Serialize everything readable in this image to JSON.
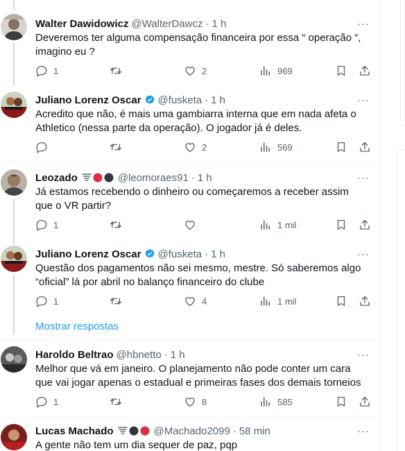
{
  "tweets": [
    {
      "name": "Walter Dawidowicz",
      "handle": "@WalterDawcz",
      "time": "1 h",
      "verified": false,
      "text": "Deveremos ter alguma compensação financeira por essa “ operação “, imagino eu ?",
      "replies": "1",
      "retweets": "",
      "likes": "2",
      "views": "969"
    },
    {
      "name": "Juliano Lorenz Oscar",
      "handle": "@fusketa",
      "time": "1 h",
      "verified": true,
      "text": "Acredito que não, é mais uma gambiarra interna que em nada afeta o Athletico (nessa parte da operação). O jogador já é deles.",
      "replies": "",
      "retweets": "",
      "likes": "2",
      "views": "569"
    },
    {
      "name": "Leozado",
      "handle": "@leomoraes91",
      "time": "1 h",
      "verified": false,
      "text": "Já estamos recebendo o dinheiro ou começaremos a receber assim que o VR partir?",
      "replies": "1",
      "retweets": "",
      "likes": "",
      "views": "1 mil"
    },
    {
      "name": "Juliano Lorenz Oscar",
      "handle": "@fusketa",
      "time": "1 h",
      "verified": true,
      "text": "Questão dos pagamentos não sei mesmo, mestre. Só saberemos algo “oficial” lá por abril no balanço financeiro do clube",
      "replies": "1",
      "retweets": "",
      "likes": "4",
      "views": "1 mil"
    },
    {
      "name": "Haroldo Beltrao",
      "handle": "@hbnetto",
      "time": "1 h",
      "verified": false,
      "text": "Melhor que vá em janeiro.  O planejamento não pode conter um cara que vai jogar apenas o estadual e primeiras fases dos demais torneios",
      "replies": "1",
      "retweets": "",
      "likes": "8",
      "views": "585"
    },
    {
      "name": "Lucas Machado",
      "handle": "@Machado2099",
      "time": "58 min",
      "verified": false,
      "text": "A gente não tem um dia sequer de paz, pqp",
      "replies": "",
      "retweets": "",
      "likes": "",
      "views": ""
    }
  ],
  "show_replies_label": "Mostrar respostas",
  "dot_separator": "·",
  "more_label": "···",
  "icons": {
    "reply": "reply-icon",
    "retweet": "retweet-icon",
    "like": "heart-icon",
    "views": "views-icon",
    "bookmark": "bookmark-icon",
    "share": "share-icon",
    "verified": "verified-badge-icon",
    "tornado": "tornado-emoji-icon",
    "red_circle": "red-circle-emoji-icon",
    "black_circle": "black-circle-emoji-icon"
  },
  "colors": {
    "text_primary": "#0f1419",
    "text_secondary": "#536471",
    "accent": "#1d9bf0",
    "divider": "#eff3f4",
    "thread_line": "#cfd9de"
  }
}
